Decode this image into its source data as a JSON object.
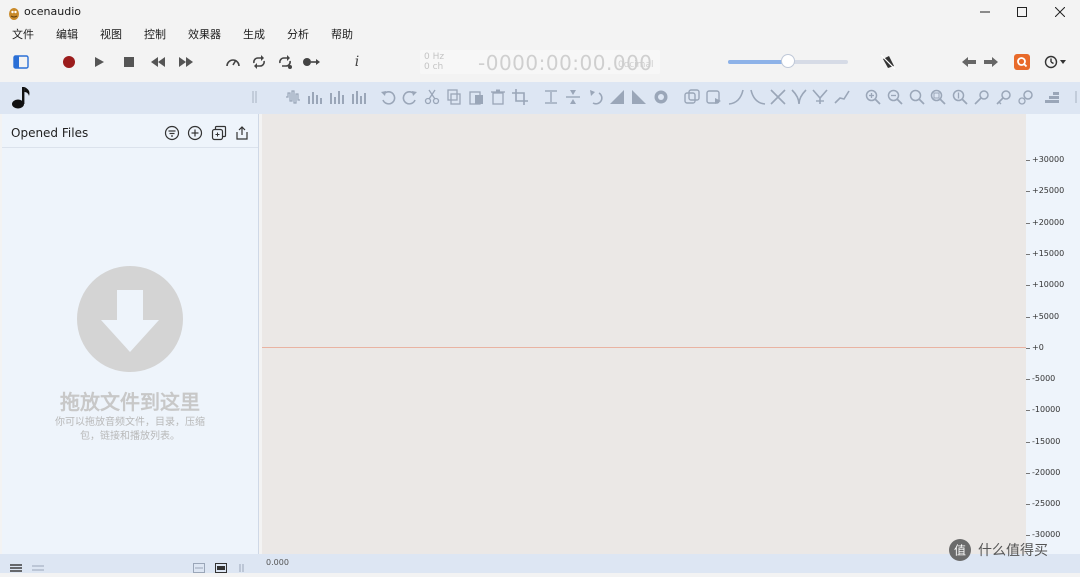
{
  "window": {
    "title": "ocenaudio"
  },
  "menu": [
    "文件",
    "编辑",
    "视图",
    "控制",
    "效果器",
    "生成",
    "分析",
    "帮助"
  ],
  "display": {
    "hz": "0 Hz",
    "ch": "0 ch",
    "time": "-0000:00:00.000",
    "format": "0ocimal"
  },
  "panel": {
    "title": "Opened Files",
    "drop_title": "拖放文件到这里",
    "drop_desc": "你可以拖放音频文件，目录，压缩包，链接和播放列表。"
  },
  "scale": [
    "+30000",
    "+25000",
    "+20000",
    "+15000",
    "+10000",
    "+5000",
    "+0",
    "-5000",
    "-10000",
    "-15000",
    "-20000",
    "-25000",
    "-30000"
  ],
  "status": {
    "position": "0.000"
  },
  "watermark": {
    "text": "什么值得买"
  },
  "colors": {
    "accent": "#e86a2a",
    "record": "#9b1c1c",
    "toolbar_bg": "#dde6f3"
  }
}
